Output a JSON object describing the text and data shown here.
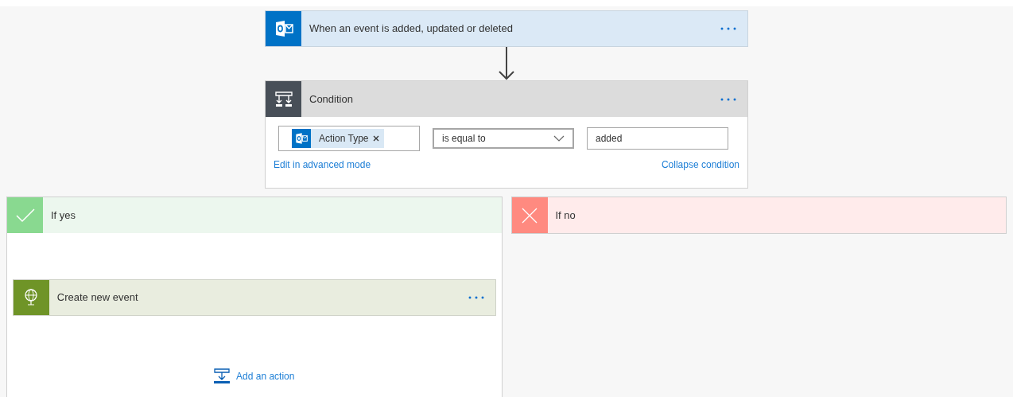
{
  "trigger": {
    "title": "When an event is added, updated or deleted"
  },
  "condition": {
    "title": "Condition",
    "token": "Action Type",
    "operator": "is equal to",
    "value": "added",
    "advanced_link": "Edit in advanced mode",
    "collapse_link": "Collapse condition"
  },
  "branches": [
    {
      "kind": "yes",
      "label": "If yes",
      "actions": [
        {
          "title": "Create new event"
        }
      ],
      "add_action": "Add an action"
    },
    {
      "kind": "no",
      "label": "If no"
    }
  ]
}
